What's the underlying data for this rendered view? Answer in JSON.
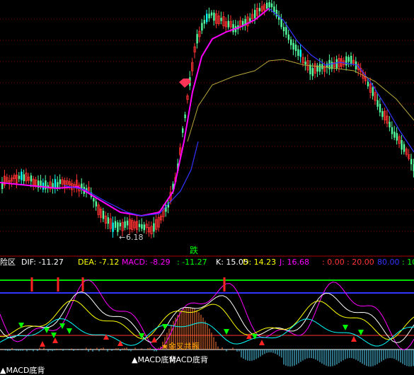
{
  "chart_data": [
    {
      "type": "candlestick",
      "panel": "price",
      "annotations": [
        {
          "text": "6.18",
          "prefix": "←",
          "kind": "low-price"
        },
        {
          "text": "跌",
          "kind": "signal"
        }
      ],
      "series": [
        {
          "name": "",
          "color": "#ff00ff",
          "kind": "moving-average"
        },
        {
          "name": "",
          "color": "#3333ff",
          "kind": "moving-average"
        },
        {
          "name": "",
          "color": "#b5a63a",
          "kind": "moving-average"
        }
      ],
      "grid": true,
      "colors": {
        "up": "#ff3333",
        "down": "#54ff9f",
        "equal": "#00ffff"
      }
    },
    {
      "type": "indicator",
      "panel": "sub",
      "header": [
        {
          "text": "险区",
          "color": "#ffffff"
        },
        {
          "text": "DIF: -11.27",
          "color": "#ffffff"
        },
        {
          "text": "DEA: -7.12",
          "color": "#ffff00"
        },
        {
          "text": "MACD: -8.29",
          "color": "#ff00ff"
        },
        {
          "text": ": -11.27",
          "color": "#00ff00"
        },
        {
          "text": "K: 15.05",
          "color": "#ffffff"
        },
        {
          "text": "D: 14.23",
          "color": "#ffff00"
        },
        {
          "text": "J: 16.68",
          "color": "#ff00ff"
        },
        {
          "text": ": 0.00",
          "color": "#ff3333"
        },
        {
          "text": ": 20.00",
          "color": "#ff3333"
        },
        {
          "text": "80.00",
          "color": "#3333ff"
        },
        {
          "text": ": 10",
          "color": "#00ff00"
        }
      ],
      "annotations": [
        {
          "text": "▲MACD底背",
          "color": "#ffffff"
        },
        {
          "text": "▲MACD底背",
          "color": "#ffffff"
        },
        {
          "text": "MACD底背",
          "color": "#ffffff"
        },
        {
          "text": "★金叉共振",
          "color": "#ffaa00"
        }
      ],
      "reference_lines": [
        {
          "color": "#00dd00"
        },
        {
          "color": "#3333ff"
        },
        {
          "color": "#ff3333"
        },
        {
          "color": "#ff3333"
        },
        {
          "color": "#ffffff"
        }
      ]
    }
  ]
}
